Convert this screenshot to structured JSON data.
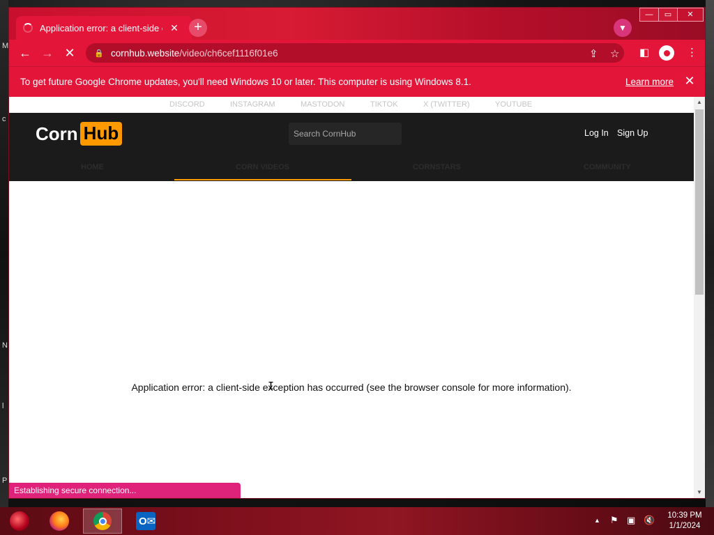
{
  "browser": {
    "tab_title": "Application error: a client-side ex",
    "new_tab": "+",
    "tab_close": "✕",
    "url_host": "cornhub.website",
    "url_path": "/video/ch6cef1116f01e6",
    "window_controls": {
      "minimize": "—",
      "maximize": "▭",
      "close": "✕"
    }
  },
  "infobar": {
    "message": "To get future Google Chrome updates, you'll need Windows 10 or later. This computer is using Windows 8.1.",
    "learn_more": "Learn more",
    "close": "✕"
  },
  "site": {
    "social_links": [
      "DISCORD",
      "INSTAGRAM",
      "MASTODON",
      "TIKTOK",
      "X (TWITTER)",
      "YOUTUBE"
    ],
    "logo_part1": "Corn",
    "logo_part2": "Hub",
    "search_placeholder": "Search CornHub",
    "login": "Log In",
    "signup": "Sign Up",
    "nav": [
      "HOME",
      "CORN VIDEOS",
      "CORNSTARS",
      "COMMUNITY"
    ],
    "accent_color": "#ff9900"
  },
  "page": {
    "error_message": "Application error: a client-side exception has occurred (see the browser console for more information)."
  },
  "status": {
    "text": "Establishing secure connection..."
  },
  "taskbar": {
    "time": "10:39 PM",
    "date": "1/1/2024",
    "outlook_letter": "O"
  },
  "colors": {
    "browser_red": "#e3163a",
    "status_pink": "#e0237a",
    "header_dark": "#1b1b1b"
  }
}
